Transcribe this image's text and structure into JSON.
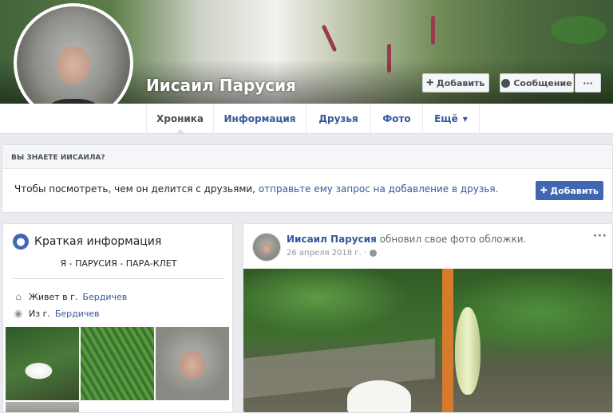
{
  "profile": {
    "name": "Иисаил Парусия"
  },
  "cover_actions": {
    "add_label": "Добавить",
    "message_label": "Сообщение",
    "more_label": "···"
  },
  "nav": {
    "tabs": [
      {
        "label": "Хроника",
        "active": true
      },
      {
        "label": "Информация"
      },
      {
        "label": "Друзья"
      },
      {
        "label": "Фото"
      },
      {
        "label": "Ещё"
      }
    ]
  },
  "know_box": {
    "heading": "ВЫ ЗНАЕТЕ ИИСАИЛА?",
    "text": "Чтобы посмотреть, чем он делится с друзьями,",
    "link": "отправьте ему запрос на добавление в друзья.",
    "button_label": "Добавить"
  },
  "intro": {
    "title": "Краткая информация",
    "bio": "Я - ПАРУСИЯ - ПАРА-КЛЕТ",
    "lives_prefix": "Живет в г.",
    "lives_city": "Бердичев",
    "from_prefix": "Из г.",
    "from_city": "Бердичев"
  },
  "post": {
    "author": "Иисаил Парусия",
    "action": "обновил свое фото обложки.",
    "date": "26 апреля 2018 г. ·",
    "more_label": "···"
  },
  "colors": {
    "link": "#365899",
    "primary_button": "#4267b2",
    "page_bg": "#e9ebee"
  }
}
